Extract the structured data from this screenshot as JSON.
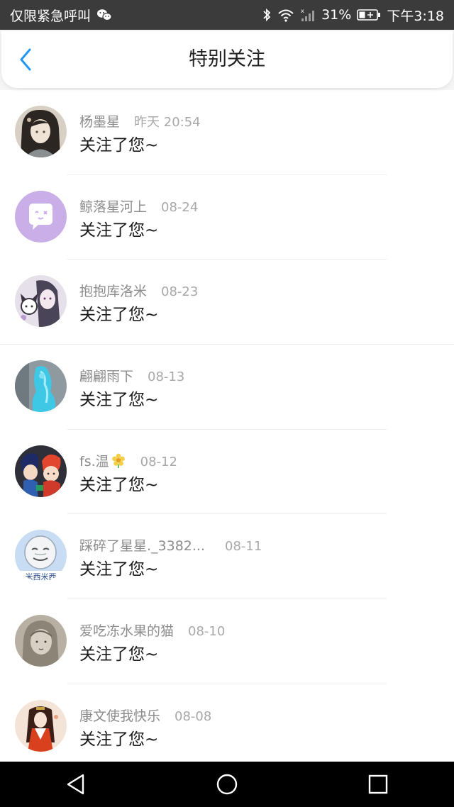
{
  "status_bar": {
    "left_text": "仅限紧急呼叫",
    "battery_percent": "31%",
    "time": "下午3:18",
    "icons": [
      "wechat-icon",
      "bluetooth-icon",
      "wifi-icon",
      "signal-icon",
      "battery-icon"
    ]
  },
  "header": {
    "title": "特别关注",
    "back_icon": "chevron-left-icon",
    "accent_color": "#2196F3"
  },
  "items": [
    {
      "name": "杨墨星",
      "time": "昨天 20:54",
      "message": "关注了您~"
    },
    {
      "name": "鲸落星河上",
      "time": "08-24",
      "message": "关注了您~"
    },
    {
      "name": "抱抱库洛米",
      "time": "08-23",
      "message": "关注了您~"
    },
    {
      "name": "翩翩雨下",
      "time": "08-13",
      "message": "关注了您~"
    },
    {
      "name": "fs.温",
      "time": "08-12",
      "message": "关注了您~"
    },
    {
      "name": "踩碎了星星._3382...",
      "time": "08-11",
      "message": "关注了您~"
    },
    {
      "name": "爱吃冻水果的猫",
      "time": "08-10",
      "message": "关注了您~"
    },
    {
      "name": "康文使我快乐",
      "time": "08-08",
      "message": "关注了您~"
    }
  ],
  "avatar_6_text": "米西米西",
  "nav_bar": [
    "back-triangle-icon",
    "home-circle-icon",
    "recents-square-icon"
  ]
}
